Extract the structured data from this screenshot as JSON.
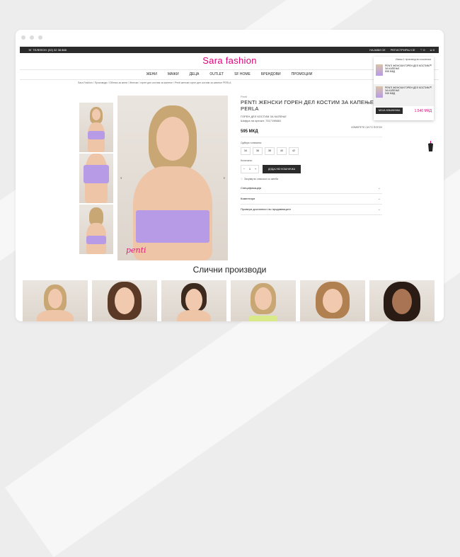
{
  "topbar": {
    "phone": "ТЕЛЕФОН: (02) 32 38 888",
    "links": [
      "НАЈАВИ СЕ",
      "РЕГИСТРИРАЈ СЕ"
    ],
    "wishlist_count": "0",
    "cart_count": "0"
  },
  "brand": {
    "logo": "Sara fashion"
  },
  "nav": {
    "items": [
      "ЖЕНИ",
      "МАЖИ",
      "ДЕЦА",
      "OUTLET",
      "SF HOME",
      "БРЕНДОВИ",
      "ПРОМОЦИИ"
    ]
  },
  "breadcrumb": "Sara Fashion / Производи / Облека за жени / Женски / горен дел костим за капење / Penti женски горен дел костим за капење PERLA",
  "product": {
    "brand": "Penti",
    "title": "PENTI ЖЕНСКИ ГОРЕН ДЕЛ КОСТИМ ЗА КАПЕЊЕ PERLA",
    "subtitle": "ГОРЕН ДЕЛ КОСТИМ ЗА КАПЕЊЕ",
    "sku": "Шифра на артикл: 7317196681",
    "stock": "ИЗМЕРЕТЕ СИ ГО ПОГОН",
    "price": "595 МКД",
    "size_label": "Одбери големина:",
    "sizes": [
      "34",
      "36",
      "38",
      "40",
      "42"
    ],
    "qty_label": "Количина:",
    "qty_value": "1",
    "qty_minus": "−",
    "qty_plus": "+",
    "add_to_cart": "ДОДАЈ ВО КОШНИЧКА",
    "wishlist": "Зачувај во списокот со желби",
    "accordions": [
      "Спецификација",
      "Коментари",
      "Провери достапност во продавниците"
    ],
    "watermark": "penti"
  },
  "cart_popup": {
    "header": "Имаш  1 производ во кошничка",
    "items": [
      {
        "name": "PENTI ЖЕНСКИ ГОРЕН ДЕЛ КОСТИМ ЗА КАПЕЊЕ",
        "price": "595 МКД"
      },
      {
        "name": "PENTI ЖЕНСКИ ГОРЕН ДЕЛ КОСТИМ ЗА КАПЕЊЕ",
        "price": "945 МКД"
      }
    ],
    "button": "МОЈА КОШНИЧКА",
    "total": "1.540 МКД"
  },
  "similar": {
    "title": "Слични производи"
  },
  "icons": {
    "phone": "phone-icon",
    "heart": "heart-icon",
    "cart": "bag-icon",
    "close": "close-icon",
    "chevron": "chevron-down-icon",
    "hanger": "hanger-icon"
  },
  "colors": {
    "brand_pink": "#e0007a",
    "dark": "#2b2b2b"
  }
}
